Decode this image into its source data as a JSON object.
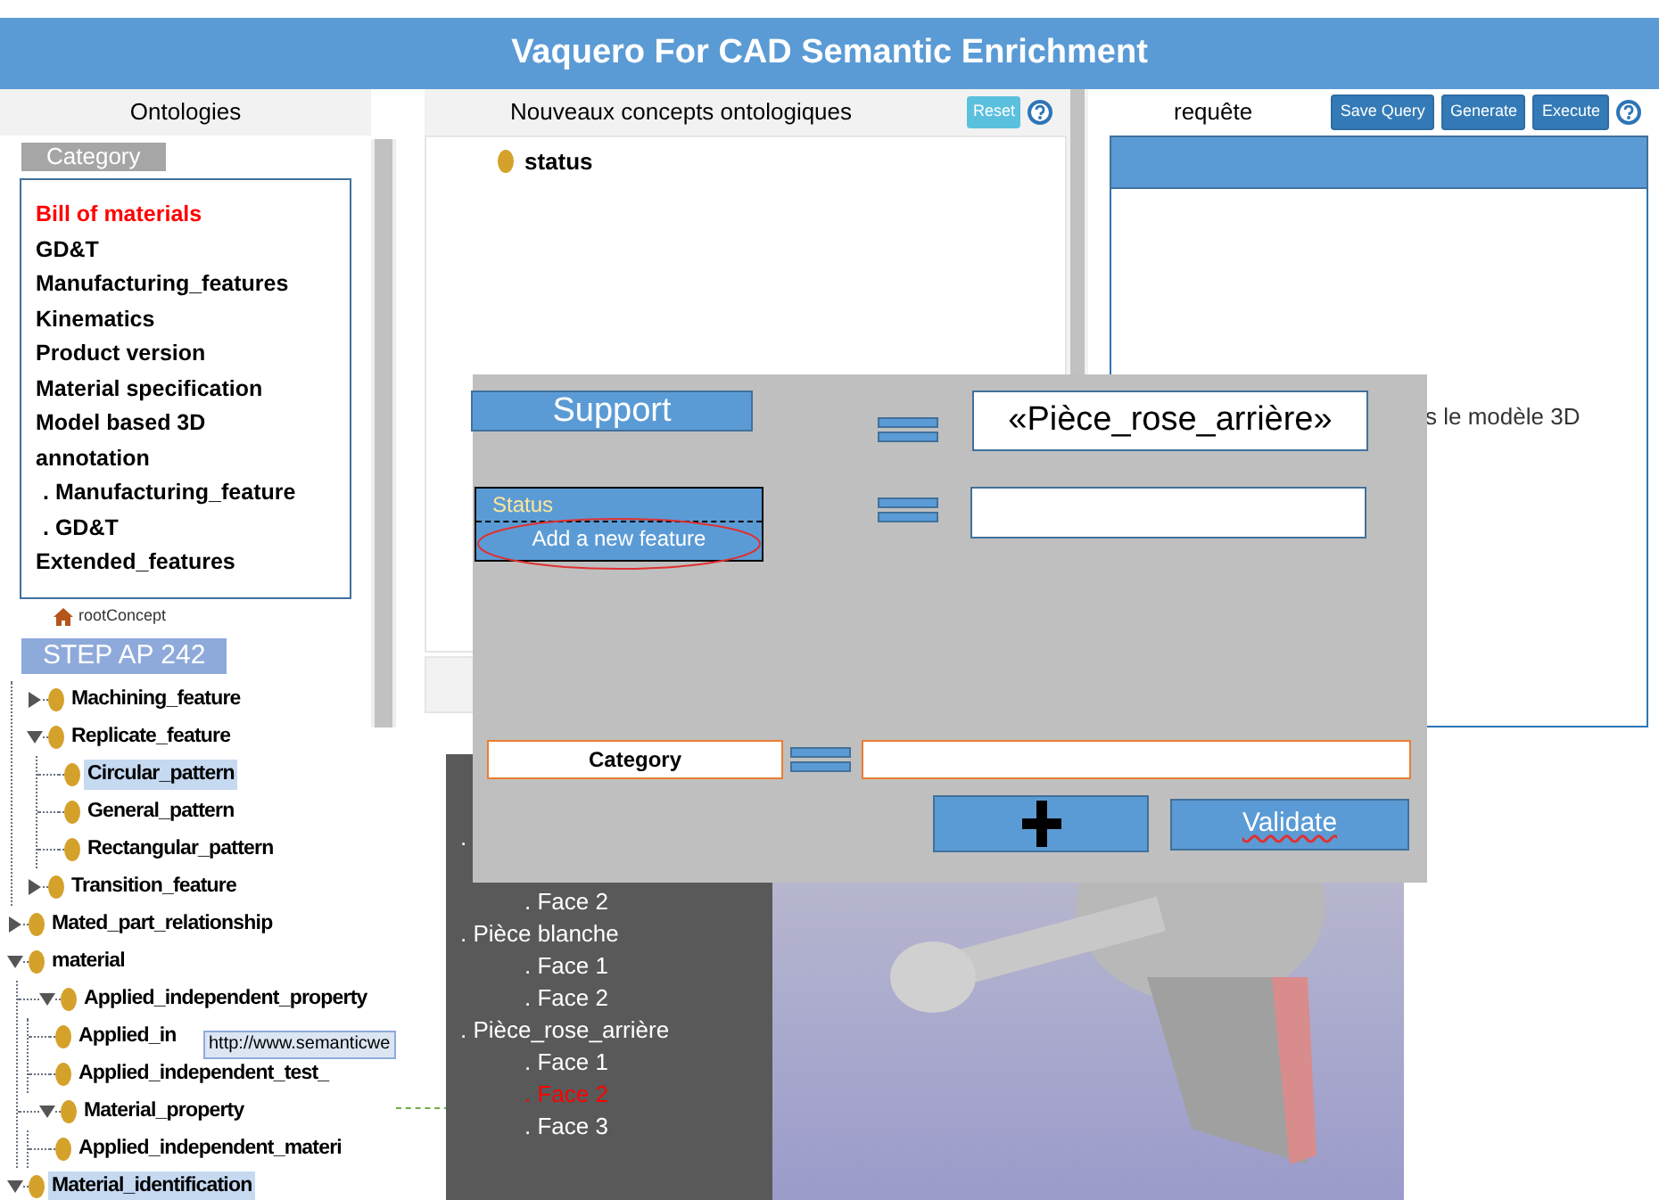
{
  "title": "Vaquero For CAD Semantic Enrichment",
  "ontologies": {
    "heading": "Ontologies",
    "tab": "Category",
    "categories": [
      {
        "label": "Bill of materials",
        "selected": true
      },
      {
        "label": "GD&T",
        "selected": false
      },
      {
        "label": "Manufacturing_features",
        "selected": false
      },
      {
        "label": "Kinematics",
        "selected": false
      },
      {
        "label": "Product version",
        "selected": false
      },
      {
        "label": "Material specification",
        "selected": false
      },
      {
        "label": "Model based 3D annotation",
        "selected": false,
        "children": [
          {
            "label": ". Manufacturing_feature",
            "selected": false
          },
          {
            "label": ". GD&T",
            "selected": false
          }
        ]
      },
      {
        "label": "Extended_features",
        "selected": false
      }
    ],
    "root": "rootConcept",
    "root_label": "STEP AP 242",
    "tree": [
      {
        "label": "Machining_feature",
        "expanded": false,
        "selected": false
      },
      {
        "label": "Replicate_feature",
        "expanded": true,
        "selected": false,
        "children": [
          {
            "label": "Circular_pattern",
            "selected": true
          },
          {
            "label": "General_pattern",
            "selected": false
          },
          {
            "label": "Rectangular_pattern",
            "selected": false
          }
        ]
      },
      {
        "label": "Transition_feature",
        "expanded": false,
        "selected": false
      }
    ],
    "tree_top": [
      {
        "label": "Mated_part_relationship",
        "expanded": false,
        "selected": false
      },
      {
        "label": "material",
        "expanded": true,
        "selected": false,
        "children": [
          {
            "label": "Applied_independent_property",
            "expanded": true,
            "selected": false,
            "children": [
              {
                "label": "Applied_in",
                "selected": false
              },
              {
                "label": "Applied_independent_test_",
                "selected": false
              }
            ]
          },
          {
            "label": "Material_property",
            "expanded": true,
            "selected": false,
            "children": [
              {
                "label": "Applied_independent_materi",
                "selected": false
              }
            ]
          }
        ]
      },
      {
        "label": "Material_identification",
        "expanded": true,
        "selected": true
      }
    ],
    "tooltip": "http://www.semanticwe"
  },
  "concepts": {
    "heading": "Nouveaux concepts ontologiques",
    "reset": "Reset",
    "items": [
      "status"
    ]
  },
  "query": {
    "heading": "requête",
    "buttons": [
      "Save Query",
      "Generate",
      "Execute"
    ],
    "hidden_text": "s le modèle 3D"
  },
  "parts": [
    {
      "name": ".",
      "children": [
        {
          "label": ". Face 2",
          "selected": false
        }
      ]
    },
    {
      "name": ". Pièce blanche",
      "children": [
        {
          "label": ". Face 1",
          "selected": false
        },
        {
          "label": ". Face 2",
          "selected": false
        }
      ]
    },
    {
      "name": ". Pièce_rose_arrière",
      "children": [
        {
          "label": ". Face 1",
          "selected": false
        },
        {
          "label": ". Face 2",
          "selected": true
        },
        {
          "label": ". Face 3",
          "selected": false
        }
      ]
    }
  ],
  "dialog": {
    "subject": "Support",
    "value": "«Pièce_rose_arrière»",
    "menu": [
      "Status",
      "Add a new feature"
    ],
    "category": "Category",
    "validate": "Validate"
  }
}
